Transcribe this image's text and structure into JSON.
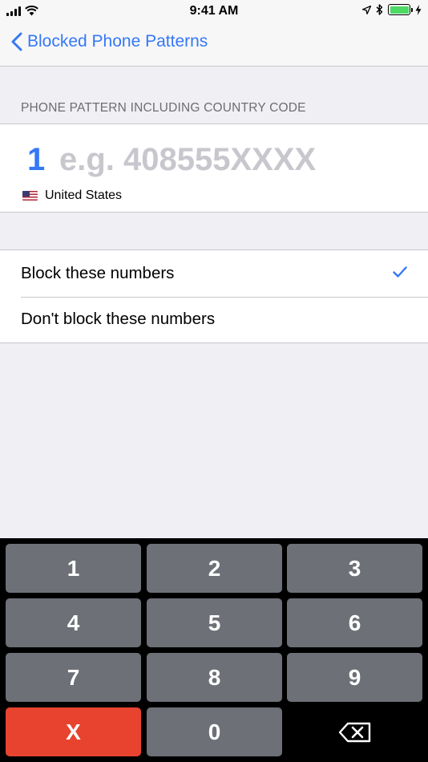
{
  "status_bar": {
    "time": "9:41 AM",
    "battery_level": 1.0
  },
  "nav": {
    "back_label": "Blocked Phone Patterns"
  },
  "pattern": {
    "section_header": "PHONE PATTERN INCLUDING COUNTRY CODE",
    "country_code": "1",
    "input_value": "",
    "placeholder": "e.g. 408555XXXX",
    "country": "United States"
  },
  "options": [
    {
      "label": "Block these numbers",
      "selected": true
    },
    {
      "label": "Don't block these numbers",
      "selected": false
    }
  ],
  "keypad": {
    "keys": [
      "1",
      "2",
      "3",
      "4",
      "5",
      "6",
      "7",
      "8",
      "9",
      "X",
      "0",
      "⌫"
    ]
  },
  "colors": {
    "accent": "#3478f6",
    "key_gray": "#6d7077",
    "clear_red": "#e8432e",
    "battery_green": "#4cd964"
  }
}
